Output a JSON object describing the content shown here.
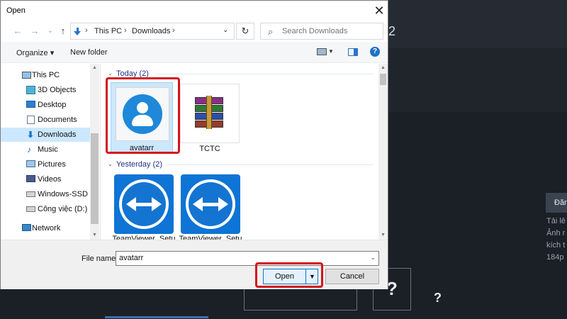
{
  "dialog": {
    "title": "Open",
    "close_glyph": "✕"
  },
  "navigation": {
    "back_glyph": "←",
    "forward_glyph": "→",
    "recent_glyph": "⌄",
    "up_glyph": "↑",
    "breadcrumb": [
      "This PC",
      "Downloads"
    ],
    "separator": "›",
    "dropdown_glyph": "⌄",
    "refresh_glyph": "↻",
    "search_placeholder": "Search Downloads",
    "search_glyph": "⌕"
  },
  "toolbar": {
    "organize": "Organize ▾",
    "new_folder": "New folder",
    "help_glyph": "?"
  },
  "sidebar": {
    "items": [
      {
        "label": "This PC",
        "icon": "computer-icon"
      },
      {
        "label": "3D Objects",
        "icon": "cube-icon"
      },
      {
        "label": "Desktop",
        "icon": "desktop-icon"
      },
      {
        "label": "Documents",
        "icon": "document-icon"
      },
      {
        "label": "Downloads",
        "icon": "download-icon",
        "selected": true
      },
      {
        "label": "Music",
        "icon": "music-icon"
      },
      {
        "label": "Pictures",
        "icon": "picture-icon"
      },
      {
        "label": "Videos",
        "icon": "video-icon"
      },
      {
        "label": "Windows-SSD (C",
        "icon": "drive-icon"
      },
      {
        "label": "Công việc (D:)",
        "icon": "drive-icon"
      },
      {
        "label": "Network",
        "icon": "network-icon"
      }
    ]
  },
  "groups": [
    {
      "header": "Today (2)",
      "files": [
        {
          "name": "avatarr",
          "icon": "user-avatar-icon",
          "selected": true
        },
        {
          "name": "TCTC",
          "icon": "winrar-archive-icon"
        }
      ]
    },
    {
      "header": "Yesterday (2)",
      "files": [
        {
          "name": "TeamViewer_Setu",
          "icon": "teamviewer-icon"
        },
        {
          "name": "TeamViewer_Setu",
          "icon": "teamviewer-icon"
        }
      ]
    }
  ],
  "footer": {
    "file_name_label": "File name:",
    "file_name_value": "avatarr",
    "open_label": "Open",
    "open_dropdown_glyph": "▼",
    "cancel_label": "Cancel"
  },
  "background": {
    "heading_number": "2",
    "button_text": "Đăn",
    "text_lines": [
      "Tải lê",
      "Ảnh r",
      "kích t",
      "184p"
    ],
    "question_glyph": "?"
  },
  "colors": {
    "accent": "#0078d7",
    "selection": "#cce8ff",
    "highlight": "#d4141c",
    "folder_header": "#1e3287"
  }
}
